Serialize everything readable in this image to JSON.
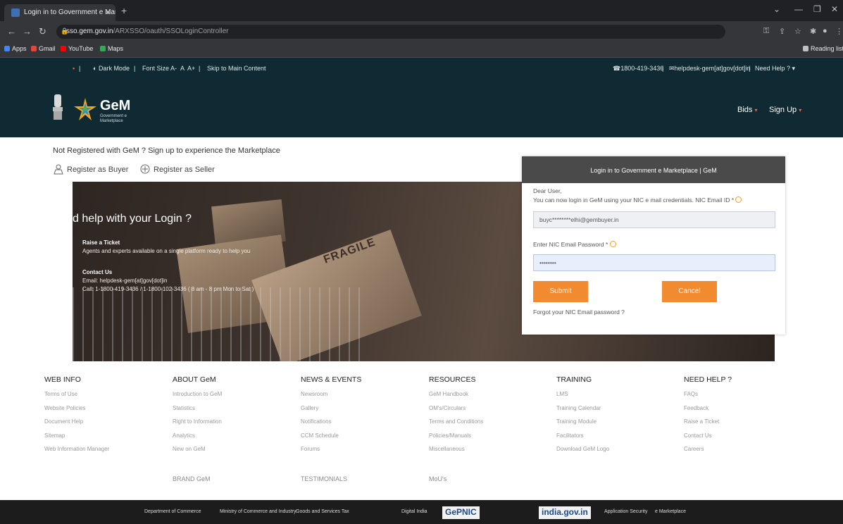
{
  "browser": {
    "tab_title": "Login in to Government e Marke",
    "url_host": "sso.gem.gov.in",
    "url_path": "/ARXSSO/oauth/SSOLoginController",
    "bookmarks": [
      "Apps",
      "Gmail",
      "YouTube",
      "Maps"
    ],
    "reading_list": "Reading list"
  },
  "topbar": {
    "dark_mode": "Dark Mode",
    "font_size": "Font Size",
    "font_a_minus": "A-",
    "font_a": "A",
    "font_a_plus": "A+",
    "skip": "Skip to Main Content",
    "phone": "1800-419-3436",
    "email": "helpdesk-gem[at]gov[dot]in",
    "need_help": "Need Help ? ▾"
  },
  "header": {
    "brand": "GeM",
    "brand_sub": "Government e Marketplace",
    "nav_bids": "Bids",
    "nav_signup": "Sign Up"
  },
  "intro": {
    "not_registered": "Not Registered with GeM ? Sign up to experience the Marketplace",
    "register_buyer": "Register as Buyer",
    "register_seller": "Register as Seller"
  },
  "banner": {
    "title": "d help with your Login ?",
    "ticket_head": "Raise a Ticket",
    "ticket_text": "Agents and experts available on a single platform ready to help you",
    "contact_head": "Contact Us",
    "contact_email": "Email: helpdesk-gem[at]gov[dot]in",
    "contact_call": "Call: 1-1800-419-3436 / 1-1800-102-3436 ( 8 am - 8 pm Mon to Sat )",
    "box_text": "FRAGILE"
  },
  "login": {
    "heading": "Login in to Government e Marketplace | GeM",
    "greeting": "Dear User,",
    "instruction": "You can now login in GeM using your NIC e mail credentials. NIC Email ID *",
    "email_value": "buyc********elhi@gembuyer.in",
    "password_label": "Enter NIC Email Password *",
    "password_value": "••••••••",
    "submit": "Submit",
    "cancel": "Cancel",
    "forgot": "Forgot your NIC Email password ?"
  },
  "footer": {
    "columns": [
      {
        "heading": "WEB INFO",
        "items": [
          "Terms of Use",
          "Website Policies",
          "Document Help",
          "Sitemap",
          "Web Information Manager"
        ],
        "extra": ""
      },
      {
        "heading": "ABOUT GeM",
        "items": [
          "Introduction to GeM",
          "Statistics",
          "Right to Information",
          "Analytics",
          "New on GeM"
        ],
        "extra": "BRAND GeM"
      },
      {
        "heading": "NEWS & EVENTS",
        "items": [
          "Newsroom",
          "Gallery",
          "Notifications",
          "CCM Schedule",
          "Forums"
        ],
        "extra": "TESTIMONIALS"
      },
      {
        "heading": "RESOURCES",
        "items": [
          "GeM Handbook",
          "OM's/Circulars",
          "Terms and Conditions",
          "Policies/Manuals",
          "Miscellaneous"
        ],
        "extra": "MoU's"
      },
      {
        "heading": "TRAINING",
        "items": [
          "LMS",
          "Training Calendar",
          "Training Module",
          "Facilitators",
          "Download GeM Logo"
        ],
        "extra": ""
      },
      {
        "heading": "NEED HELP ?",
        "items": [
          "FAQs",
          "Feedback",
          "Raise a Ticket",
          "Contact Us",
          "Careers"
        ],
        "extra": ""
      }
    ],
    "partners": [
      "Department of Commerce",
      "Ministry of Commerce and Industry",
      "Goods and Services Tax",
      "Digital India",
      "GePNIC",
      "india.gov.in",
      "Application Security",
      "e Marketplace"
    ]
  },
  "colors": {
    "header_bg": "#102a33",
    "accent": "#f28a30",
    "login_head": "#4a4a4a"
  }
}
